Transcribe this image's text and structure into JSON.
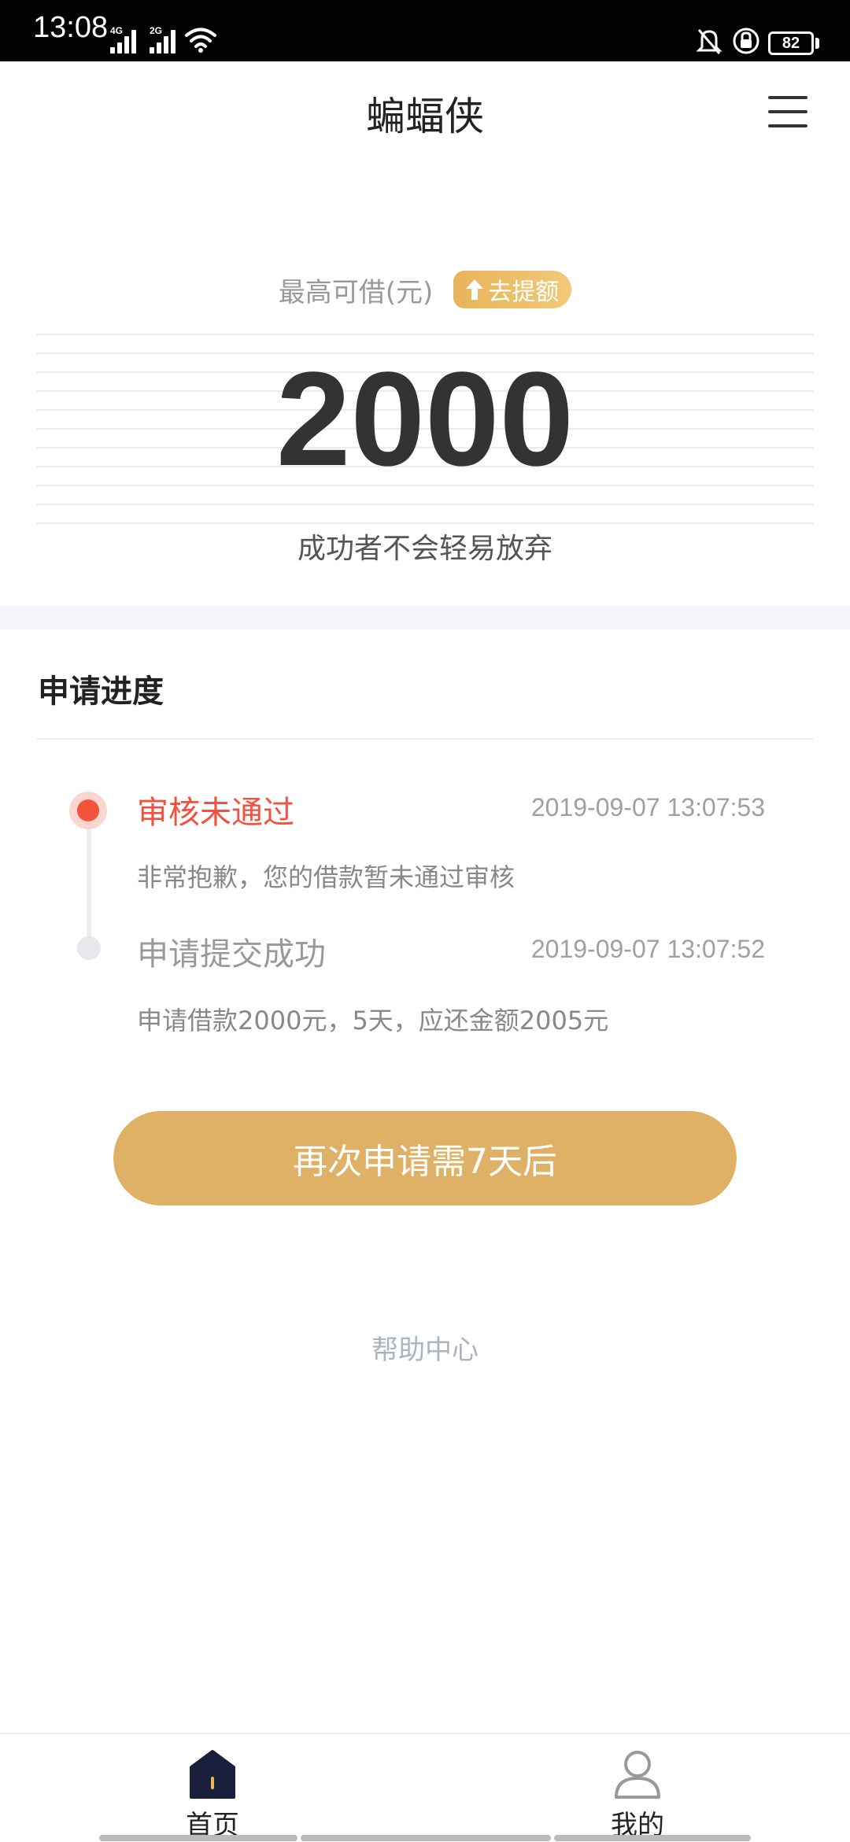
{
  "status_bar": {
    "time": "13:08",
    "network_1": "4G",
    "network_2": "2G",
    "battery": "82",
    "icons": [
      "signal-icon",
      "wifi-icon",
      "bell-off-icon",
      "rotation-lock-icon",
      "battery-icon"
    ]
  },
  "header": {
    "title": "蝙蝠侠",
    "menu_icon": "menu-icon"
  },
  "credit": {
    "label": "最高可借(元)",
    "raise_button": "去提额",
    "amount": "2000",
    "slogan": "成功者不会轻易放弃"
  },
  "progress": {
    "title": "申请进度",
    "steps": [
      {
        "title": "审核未通过",
        "time": "2019-09-07 13:07:53",
        "desc": "非常抱歉，您的借款暂未通过审核",
        "active": true
      },
      {
        "title": "申请提交成功",
        "time": "2019-09-07 13:07:52",
        "desc": "申请借款2000元，5天，应还金额2005元",
        "active": false
      }
    ]
  },
  "reapply_button": "再次申请需7天后",
  "help_link": "帮助中心",
  "bottom_nav": {
    "items": [
      {
        "label": "首页",
        "icon": "home-icon",
        "active": true
      },
      {
        "label": "我的",
        "icon": "user-icon",
        "active": false
      }
    ]
  },
  "colors": {
    "accent_gold": "#dfb166",
    "error_red": "#f25140",
    "help_gray": "#aab4c2"
  }
}
